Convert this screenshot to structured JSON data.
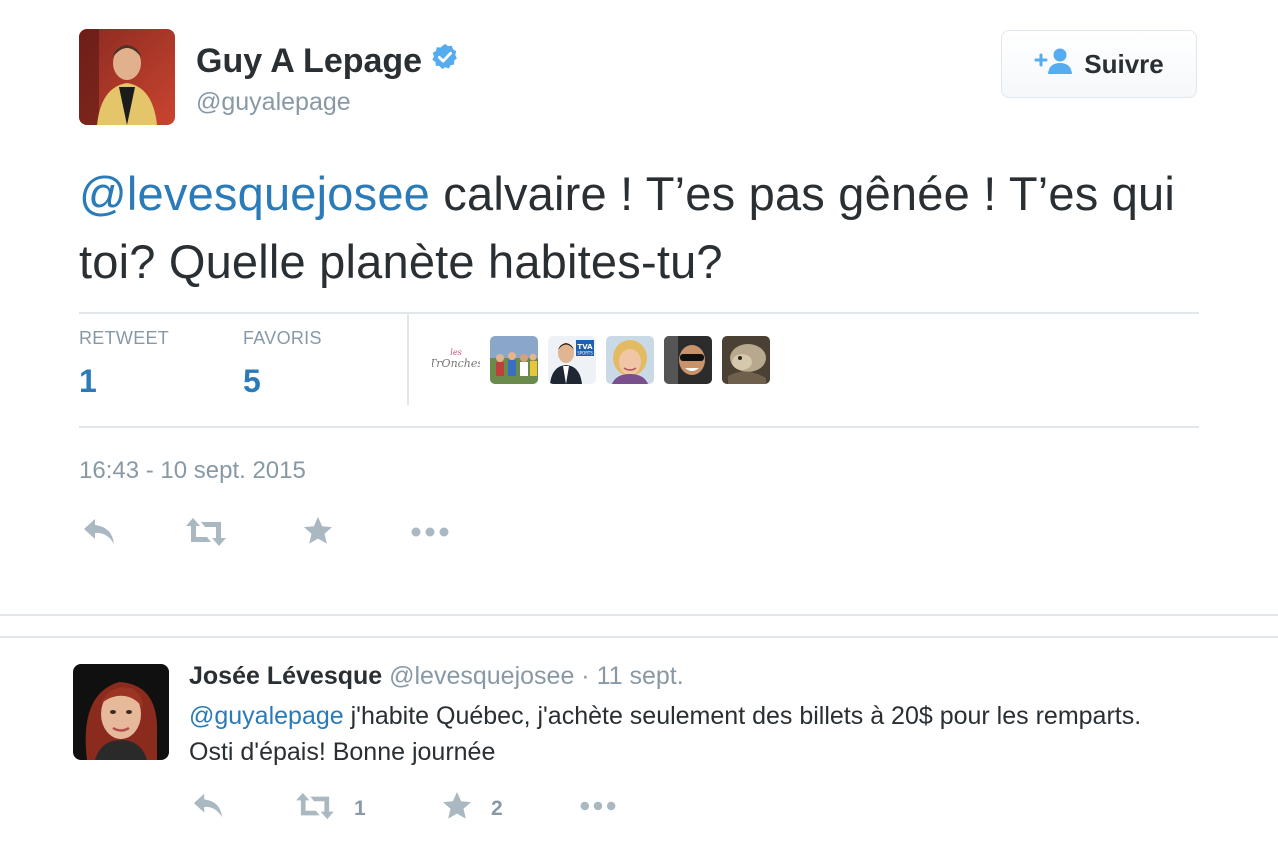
{
  "tweet": {
    "author_name": "Guy A Lepage",
    "author_handle": "@guyalepage",
    "follow_label": "Suivre",
    "mention": "@levesquejosee",
    "text": " calvaire ! T’es pas gênée ! T’es qui toi? Quelle planète habites-tu?",
    "stats": {
      "retweet_label": "RETWEET",
      "retweet_count": "1",
      "favorites_label": "FAVORIS",
      "favorites_count": "5"
    },
    "fav_badge_line1": "les",
    "fav_badge_line2": "TrOnches",
    "tva_text": "TVA",
    "tva_sub": "SPORTS",
    "timestamp": "16:43 - 10 sept. 2015"
  },
  "reply": {
    "author_name": "Josée Lévesque",
    "author_handle": "@levesquejosee",
    "date": "· 11 sept.",
    "mention": "@guyalepage",
    "text": " j'habite Québec, j'achète seulement des billets à 20$ pour les remparts.   Osti d'épais! Bonne journée",
    "retweet_count": "1",
    "favorite_count": "2"
  },
  "icons": {
    "verified": "verified-badge-icon",
    "follow": "add-user-icon",
    "reply": "reply-icon",
    "retweet": "retweet-icon",
    "favorite": "star-icon",
    "more": "more-dots-icon"
  },
  "colors": {
    "link": "#2b7bb9",
    "muted": "#8899a6",
    "text": "#292f33",
    "verified": "#55acee",
    "icon": "#aab8c2",
    "divider": "#e1e8ed"
  }
}
